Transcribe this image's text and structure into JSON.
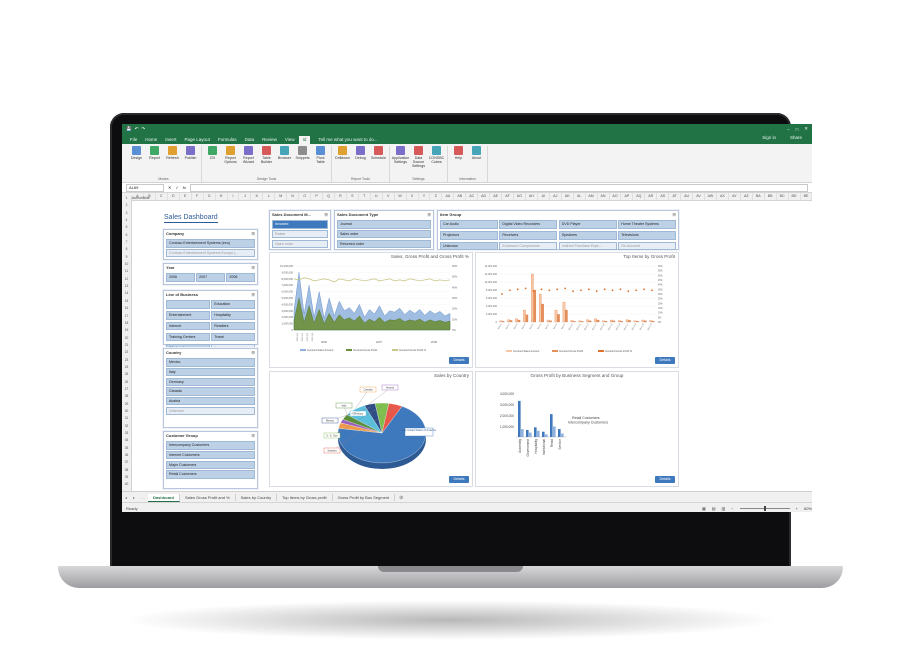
{
  "excel": {
    "title_right": "Sign in",
    "share_label": "Share",
    "tabs": [
      "File",
      "Home",
      "Insert",
      "Page Layout",
      "Formulas",
      "Data",
      "Review",
      "View",
      "Id"
    ],
    "active_tab": "Id",
    "tell_me": "Tell me what you want to do...",
    "ribbon_groups": [
      {
        "label": "Modes",
        "buttons": [
          "Design",
          "Report",
          "Refresh",
          "Publish"
        ]
      },
      {
        "label": "Design Tools",
        "buttons": [
          "Z/X",
          "Report Options",
          "Report Wizard",
          "Table Builder",
          "Browser",
          "Snippets",
          "Pivot Table"
        ]
      },
      {
        "label": "Report Tools",
        "buttons": [
          "Drilldown",
          "Debug",
          "Schedule"
        ]
      },
      {
        "label": "Settings",
        "buttons": [
          "Application Settings",
          "Data Source Settings",
          "CONSBC Cubes"
        ]
      },
      {
        "label": "Information",
        "buttons": [
          "Help",
          "About"
        ]
      }
    ],
    "name_box": "AL69",
    "columns": [
      "A",
      "B",
      "C",
      "D",
      "E",
      "F",
      "G",
      "H",
      "I",
      "J",
      "K",
      "L",
      "M",
      "N",
      "O",
      "P",
      "Q",
      "R",
      "S",
      "T",
      "U",
      "V",
      "W",
      "X",
      "Y",
      "Z",
      "AA",
      "AB",
      "AC",
      "AD",
      "AE",
      "AF",
      "AG",
      "AH",
      "AI",
      "AJ",
      "AK",
      "AL",
      "AM",
      "AN",
      "AO",
      "AP",
      "AQ",
      "AR",
      "AS",
      "AT",
      "AU",
      "AV",
      "AW",
      "AX",
      "AY",
      "AZ",
      "BA",
      "BB",
      "BC",
      "BD",
      "BE"
    ],
    "sheet_author_label": "AuthorWide",
    "sheet_tabs": [
      "Dashboard",
      "Sales Gross Profit and %",
      "Sales by Country",
      "Top Items by Gross profit",
      "Gross Profit by Bus Segment"
    ],
    "active_sheet": "Dashboard",
    "status_ready": "Ready",
    "zoom": "60%"
  },
  "dashboard": {
    "title": "Sales Dashboard",
    "slicers": {
      "company": {
        "title": "Company",
        "items": [
          "Contoso Entertainment Systems (eeu)",
          "Contoso Entertainment Systems Europe (..."
        ],
        "dim": [
          1
        ]
      },
      "year": {
        "title": "Year",
        "items": [
          "2006",
          "2007",
          "2008"
        ]
      },
      "line_of_business": {
        "title": "Line of Business",
        "items": [
          "",
          "Education",
          "Entertainment",
          "Hospitality",
          "Internet",
          "Retailers",
          "Training Centers",
          "Travel",
          "Wholesalers",
          "Emerging markets"
        ],
        "dim": [
          9
        ]
      },
      "country": {
        "title": "Country",
        "items": [
          "Mexico",
          "Italy",
          "Germany",
          "Canada",
          "Austria",
          "Unknown"
        ],
        "dim": [
          5
        ]
      },
      "customer_group": {
        "title": "Customer Group",
        "items": [
          "Intercompany Customers",
          "Internet Customers",
          "Major Customers",
          "Retail Customers"
        ]
      },
      "sales_document_m": {
        "title": "Sales Document M...",
        "items": [
          "Invoiced",
          "Roster",
          "Open order"
        ],
        "sel": [
          0
        ],
        "dim": [
          1,
          2
        ]
      },
      "sales_document_type": {
        "title": "Sales Document Type",
        "items": [
          "Journal",
          "Sales order",
          "Returned order"
        ]
      },
      "item_group": {
        "title": "Item Group",
        "items": [
          "Car Audio",
          "Digital Video Recorders",
          "DVD Player",
          "Home Theater Systems",
          "Projectors",
          "Receivers",
          "Speakers",
          "Televisions",
          "Unknown",
          "Enclosure Components",
          "Indirect Purchase Expe...",
          "On Account"
        ],
        "dim": [
          9,
          10,
          11
        ]
      }
    },
    "details_label": "Details"
  },
  "chart_data": [
    {
      "type": "area",
      "title": "Sales, Gross Profit and Gross Profit %",
      "y_ticks": [
        "10,000,000",
        "9,000,000",
        "8,000,000",
        "7,000,000",
        "6,000,000",
        "5,000,000",
        "4,000,000",
        "3,000,000",
        "2,000,000",
        "1,000,000",
        "0"
      ],
      "y2_ticks": [
        "60%",
        "50%",
        "40%",
        "30%",
        "20%",
        "10%",
        "0%"
      ],
      "x_years": [
        "2006",
        "2007",
        "2008"
      ],
      "x_labels": [
        "2006 Q1",
        "2006 Q2",
        "2006 Q3",
        "2006 Q4"
      ],
      "series": [
        {
          "name": "Invoiced Sales Amount",
          "color": "#8fb1dd",
          "values": [
            3,
            9,
            2.5,
            7,
            2,
            6,
            1.8,
            5,
            2.2,
            4.5,
            3,
            3.5,
            2.6,
            4,
            2,
            3.2,
            2.5,
            3.8,
            2.2,
            3,
            2.8,
            3.4,
            2.4,
            3.1,
            2.6,
            3.2,
            2.3,
            3,
            2.5,
            2.9,
            2.2,
            2.6
          ]
        },
        {
          "name": "Invoiced Gross Profit",
          "color": "#6b8f3a",
          "values": [
            1.5,
            5,
            1.2,
            3.8,
            1.1,
            3.2,
            1,
            2.6,
            1.2,
            2.4,
            1.6,
            1.9,
            1.4,
            2.2,
            1.1,
            1.7,
            1.3,
            2,
            1.2,
            1.6,
            1.5,
            1.8,
            1.3,
            1.6,
            1.4,
            1.7,
            1.2,
            1.6,
            1.3,
            1.5,
            1.2,
            1.4
          ]
        },
        {
          "name": "Invoiced Gross Profit %",
          "color": "#c9c88a",
          "values": [
            48,
            47,
            49,
            48,
            46,
            47,
            48,
            47,
            45,
            48,
            47,
            46,
            48,
            47,
            46,
            47,
            48,
            46,
            47,
            48,
            46,
            47,
            46,
            48,
            47,
            46,
            47,
            48,
            46,
            47,
            46,
            47
          ]
        }
      ]
    },
    {
      "type": "bar",
      "title": "Top Items by Gross Profit",
      "y_ticks": [
        "14,000,000",
        "12,000,000",
        "10,000,000",
        "8,000,000",
        "6,000,000",
        "4,000,000",
        "2,000,000",
        "0"
      ],
      "y2_ticks": [
        "60%",
        "55%",
        "50%",
        "45%",
        "40%",
        "35%",
        "30%",
        "25%",
        "20%",
        "15%",
        "10%",
        "5%",
        "0%"
      ],
      "categories": [
        "Item 1",
        "Item 2",
        "Item 3",
        "Item 4",
        "Item 5",
        "Item 6",
        "Item 7",
        "Item 8",
        "Item 9",
        "Item 10",
        "Item 11",
        "Item 12",
        "Item 13",
        "Item 14",
        "Item 15",
        "Item 16",
        "Item 17",
        "Item 18",
        "Item 19",
        "Item 20"
      ],
      "series": [
        {
          "name": "Invoiced Sales Amount",
          "color": "#f7c6a4",
          "values": [
            0.3,
            0.6,
            0.8,
            3,
            12,
            7,
            0.5,
            3,
            5,
            0.4,
            0.3,
            0.6,
            0.8,
            0.3,
            0.5,
            0.4,
            0.6,
            0.3,
            0.5,
            0.4
          ]
        },
        {
          "name": "Invoiced Gross Profit",
          "color": "#e58f5b",
          "values": [
            0.2,
            0.4,
            0.5,
            1.8,
            8,
            4.5,
            0.3,
            1.9,
            3,
            0.2,
            0.2,
            0.3,
            0.5,
            0.2,
            0.3,
            0.2,
            0.4,
            0.2,
            0.3,
            0.2
          ]
        },
        {
          "name": "Invoiced Gross Profit %",
          "color": "#e0702a",
          "values": [
            30,
            34,
            35,
            36,
            33,
            35,
            34,
            35,
            36,
            33,
            34,
            35,
            33,
            35,
            34,
            35,
            33,
            34,
            35,
            34
          ]
        }
      ]
    },
    {
      "type": "pie",
      "title": "Sales by Country",
      "slices": [
        {
          "label": "The United States of America",
          "value": 70,
          "color": "#3e78bd"
        },
        {
          "label": "Canada",
          "value": 3,
          "color": "#f29a4a"
        },
        {
          "label": "Austria",
          "value": 2,
          "color": "#9b5fc0"
        },
        {
          "label": "Italy",
          "value": 3,
          "color": "#5b8f3a"
        },
        {
          "label": "Germany",
          "value": 8,
          "color": "#5bc0de"
        },
        {
          "label": "Mexico",
          "value": 4,
          "color": "#2e4d86"
        },
        {
          "label": "U. S. Gov",
          "value": 5,
          "color": "#7fbf4d"
        },
        {
          "label": "Sweden",
          "value": 5,
          "color": "#e8574a"
        }
      ]
    },
    {
      "type": "bar",
      "title": "Gross Profit by Business Segment and Group",
      "y_ticks": [
        "4,000,000",
        "3,000,000",
        "2,000,000",
        "1,000,000"
      ],
      "categories": [
        "Assembly",
        "Government",
        "Hospitality",
        "Institutional",
        "Retail",
        "Service"
      ],
      "series": [
        {
          "name": "Retail Customers",
          "color": "#3e78bd",
          "values": [
            4.1,
            0.8,
            1.1,
            0.6,
            2.6,
            0.9
          ]
        },
        {
          "name": "Intercompany Customers",
          "color": "#8fb1dd",
          "values": [
            0.9,
            0.5,
            0.7,
            0.3,
            1.2,
            0.4
          ]
        }
      ]
    }
  ]
}
